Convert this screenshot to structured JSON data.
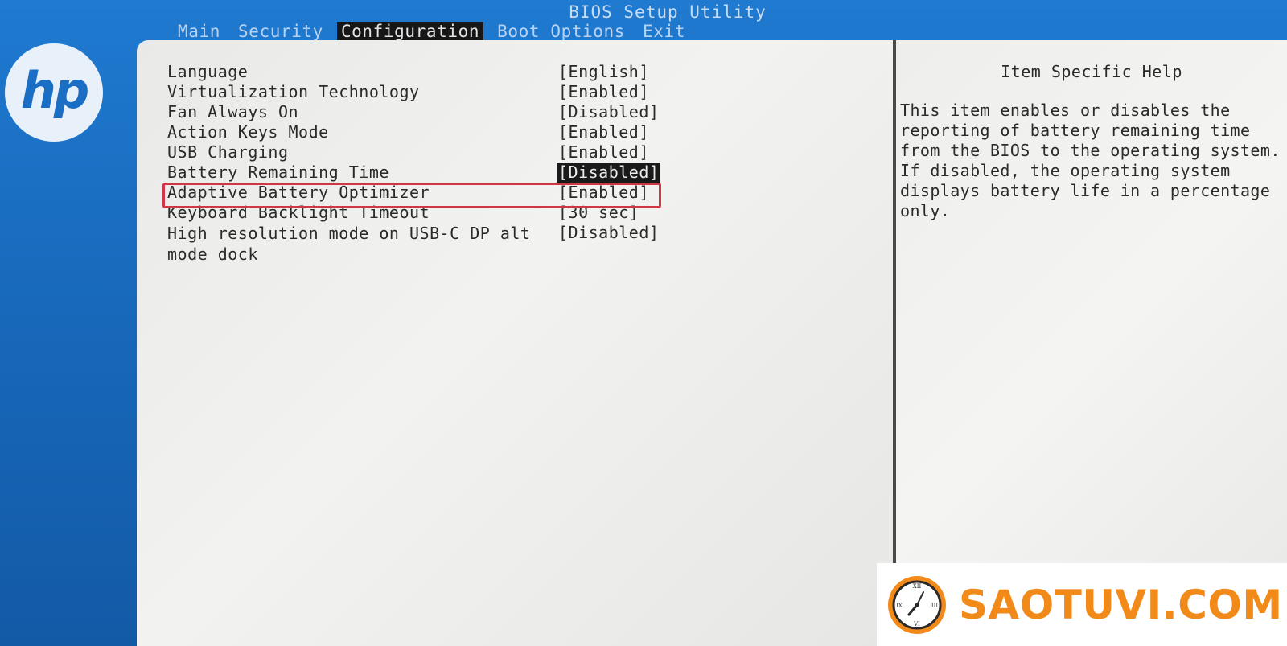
{
  "window": {
    "title": "BIOS Setup Utility"
  },
  "menu": [
    {
      "label": "Main",
      "active": false
    },
    {
      "label": "Security",
      "active": false
    },
    {
      "label": "Configuration",
      "active": true
    },
    {
      "label": "Boot Options",
      "active": false
    },
    {
      "label": "Exit",
      "active": false
    }
  ],
  "settings": [
    {
      "label": "Language",
      "value": "[English]"
    },
    {
      "label": "Virtualization Technology",
      "value": "[Enabled]"
    },
    {
      "label": "Fan Always On",
      "value": "[Disabled]"
    },
    {
      "label": "Action Keys Mode",
      "value": "[Enabled]"
    },
    {
      "label": "USB Charging",
      "value": "[Enabled]"
    },
    {
      "label": "Battery Remaining Time",
      "value": "[Disabled]",
      "selected": true
    },
    {
      "label": "Adaptive Battery Optimizer",
      "value": "[Enabled]",
      "highlighted": true
    },
    {
      "label": "Keyboard Backlight Timeout",
      "value": "[30 sec]"
    },
    {
      "label": "High resolution mode on USB-C DP alt mode dock",
      "value": "[Disabled]"
    }
  ],
  "help": {
    "title": "Item Specific Help",
    "text": "This item enables or disables the reporting of battery remaining time from the BIOS to the operating system. If disabled, the operating system displays battery life in a percentage only."
  },
  "logo": {
    "text": "hp",
    "icon": "hp-logo"
  },
  "watermark": {
    "text": "SAOTUVI.COM",
    "icon": "clock-icon"
  },
  "colors": {
    "background": "#1a6fc4",
    "panel": "#efefed",
    "selected_bg": "#1a1a1a",
    "highlight_border": "#d0364a",
    "watermark_text": "#f28a1a"
  }
}
